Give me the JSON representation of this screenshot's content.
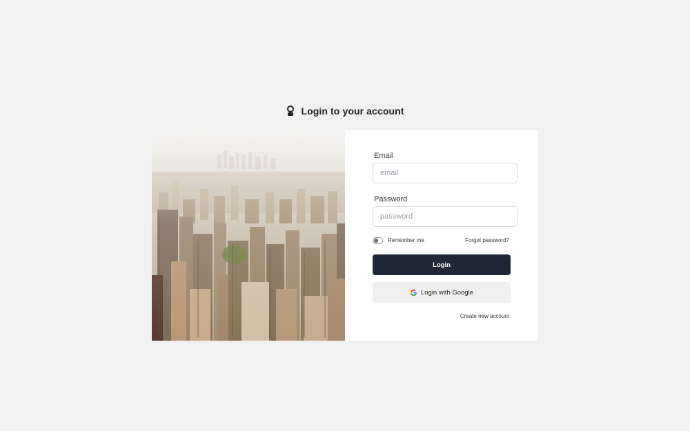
{
  "header": {
    "title": "Login to your account",
    "icon": "user-key-icon"
  },
  "image": {
    "description_icon": "city-skyline-photo"
  },
  "form": {
    "email_label": "Email",
    "email_placeholder": "email",
    "email_value": "",
    "password_label": "Password",
    "password_placeholder": "password",
    "password_value": "",
    "remember_label": "Remember me",
    "remember_checked": false,
    "forgot_label": "Forgot password?",
    "login_label": "Login",
    "google_label": "Login with Google",
    "google_icon": "google-g-icon",
    "create_account_label": "Create new account"
  },
  "colors": {
    "page_bg": "#f1f1f1",
    "card_bg": "#ffffff",
    "primary_button": "#1f2736",
    "secondary_button": "#f0f0f1"
  }
}
